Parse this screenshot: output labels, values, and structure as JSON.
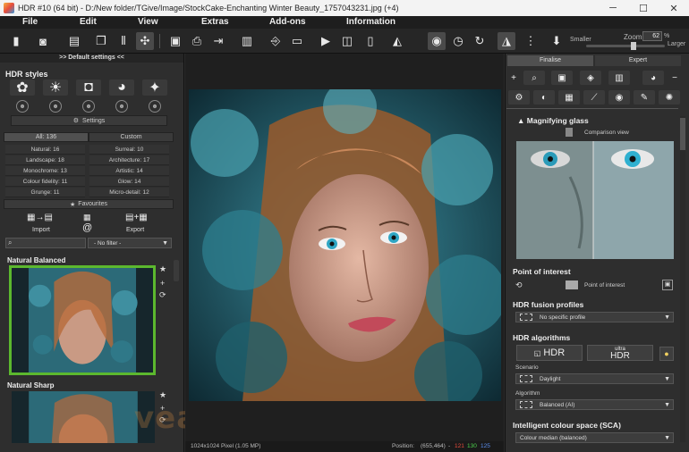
{
  "titlebar": {
    "title": "HDR #10 (64 bit) - D:/New folder/TGive/Image/StockCake-Enchanting Winter Beauty_1757043231.jpg (+4)",
    "minimize": "─",
    "maximize": "☐",
    "close": "✕"
  },
  "menu": [
    "File",
    "Edit",
    "View",
    "Extras",
    "Add-ons",
    "Information"
  ],
  "toolbar": {
    "zoom_label": "Zoom",
    "zoom_value": "62",
    "zoom_unit": "%",
    "smaller": "Smaller",
    "larger": "Larger"
  },
  "left": {
    "header": ">> Default settings <<",
    "hdr_styles_title": "HDR styles",
    "settings_label": "Settings",
    "tabs": {
      "all": "All: 136",
      "custom": "Custom"
    },
    "categories": [
      [
        "Natural: 16",
        "Surreal: 10"
      ],
      [
        "Landscape: 18",
        "Architecture: 17"
      ],
      [
        "Monochrome: 13",
        "Artistic: 14"
      ],
      [
        "Colour fidelity: 11",
        "Glow: 14"
      ],
      [
        "Grunge: 11",
        "Micro-detail: 12"
      ]
    ],
    "favourites": "Favourites",
    "import": "Import",
    "export": "Export",
    "filter": "- No filter -",
    "presets": [
      "Natural Balanced",
      "Natural Sharp"
    ]
  },
  "status": {
    "dimensions": "1024x1024 Pixel (1.05 MP)",
    "position_label": "Position:",
    "position": "(655,464)",
    "r": "121",
    "g": "130",
    "b": "125",
    "sep": "-"
  },
  "right": {
    "tabs": [
      "Finalise",
      "Expert"
    ],
    "magnifier": "Magnifying glass",
    "comparison": "Comparison view",
    "poi_title": "Point of interest",
    "poi_label": "Point of interest",
    "fusion_title": "HDR fusion profiles",
    "fusion_value": "No specific profile",
    "algo_title": "HDR algorithms",
    "hdr_btn": "HDR",
    "ultra_small": "ultra",
    "ultra_btn": "HDR",
    "scenario_label": "Scenario",
    "scenario_value": "Daylight",
    "algorithm_label": "Algorithm",
    "algorithm_value": "Balanced (AI)",
    "sca_title": "Intelligent colour space (SCA)",
    "sca_value": "Colour median (balanced)"
  },
  "watermark": "veaway",
  "colors": {
    "accent_green": "#5cb82e",
    "bg": "#2b2b2b"
  }
}
